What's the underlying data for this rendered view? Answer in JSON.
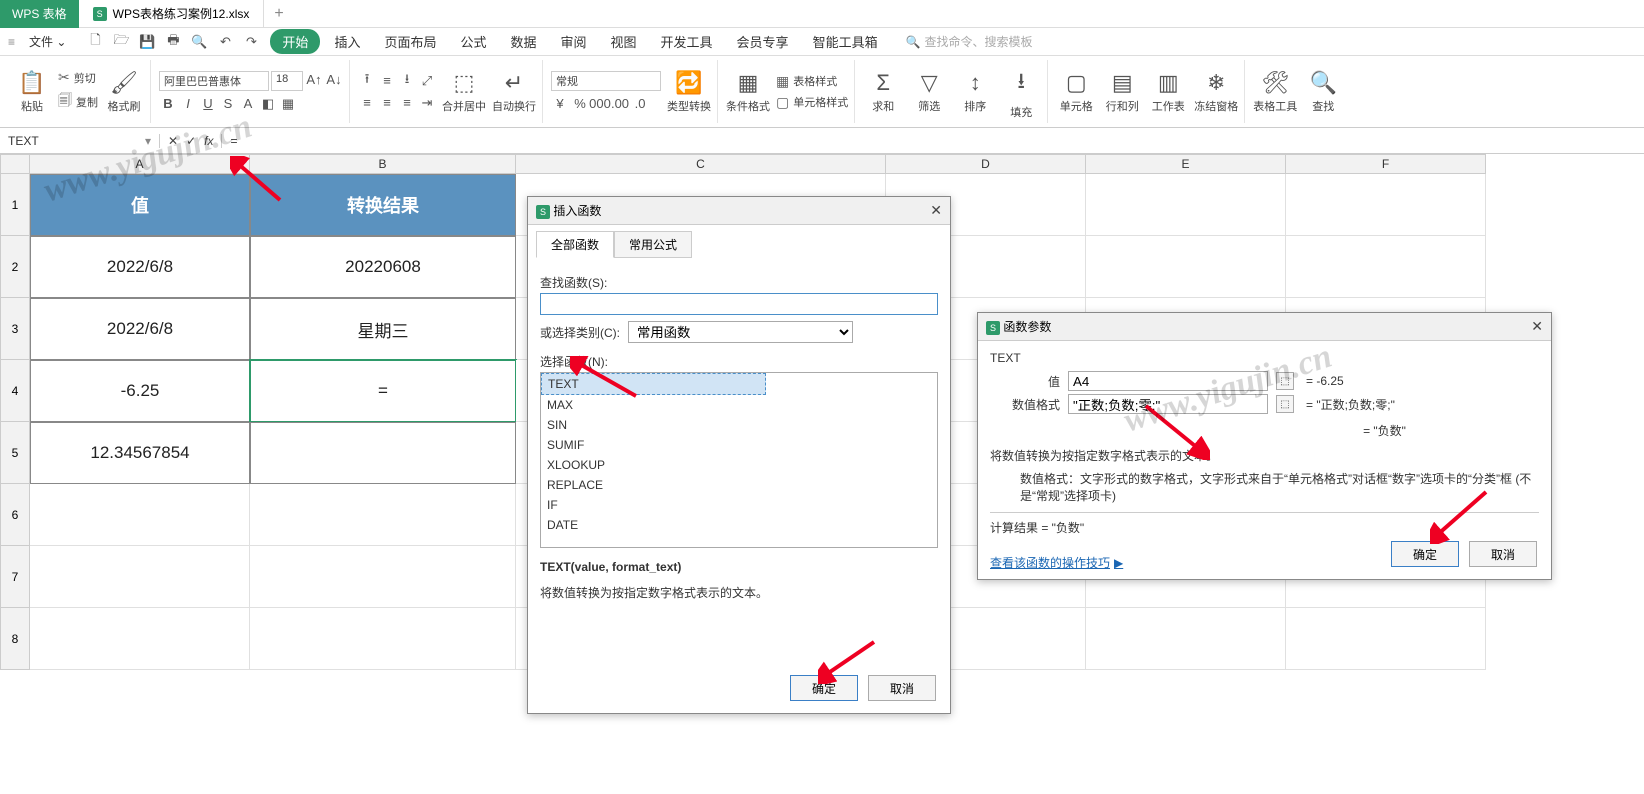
{
  "app_brand": "WPS 表格",
  "tab": {
    "filename": "WPS表格练习案例12.xlsx",
    "add": "+"
  },
  "file_menu": "文件",
  "menus": [
    "开始",
    "插入",
    "页面布局",
    "公式",
    "数据",
    "审阅",
    "视图",
    "开发工具",
    "会员专享",
    "智能工具箱"
  ],
  "search_placeholder": "查找命令、搜索模板",
  "ribbon": {
    "paste": "粘贴",
    "cut": "剪切",
    "copy": "复制",
    "format_painter": "格式刷",
    "font_family": "阿里巴巴普惠体",
    "font_size": "18",
    "merge": "合并居中",
    "wrap": "自动换行",
    "num_format": "常规",
    "type_convert": "类型转换",
    "cond_format": "条件格式",
    "table_style": "表格样式",
    "cell_style": "单元格样式",
    "sum": "求和",
    "filter": "筛选",
    "sort": "排序",
    "fill": "填充",
    "cell": "单元格",
    "rowcol": "行和列",
    "sheet": "工作表",
    "freeze": "冻结窗格",
    "tools": "表格工具",
    "find": "查找"
  },
  "name_box": "TEXT",
  "formula_input": "=",
  "cols": {
    "A": "A",
    "B": "B",
    "C": "C",
    "D": "D",
    "E": "E",
    "F": "F"
  },
  "sheet": {
    "headers": {
      "A": "值",
      "B": "转换结果"
    },
    "rows": [
      {
        "r": 2,
        "A": "2022/6/8",
        "B": "20220608"
      },
      {
        "r": 3,
        "A": "2022/6/8",
        "B": "星期三"
      },
      {
        "r": 4,
        "A": "-6.25",
        "B": "="
      },
      {
        "r": 5,
        "A": "12.34567854",
        "B": ""
      }
    ]
  },
  "dlg1": {
    "title": "插入函数",
    "tabs": {
      "all": "全部函数",
      "common": "常用公式"
    },
    "search_label": "查找函数(S):",
    "cat_label": "或选择类别(C):",
    "cat_value": "常用函数",
    "list_label": "选择函数(N):",
    "functions": [
      "TEXT",
      "MAX",
      "SIN",
      "SUMIF",
      "XLOOKUP",
      "REPLACE",
      "IF",
      "DATE"
    ],
    "sig": "TEXT(value, format_text)",
    "desc": "将数值转换为按指定数字格式表示的文本。",
    "ok": "确定",
    "cancel": "取消"
  },
  "dlg2": {
    "title": "函数参数",
    "fn": "TEXT",
    "p1_lbl": "值",
    "p1_val": "A4",
    "p1_res": "= -6.25",
    "p2_lbl": "数值格式",
    "p2_val": "\"正数;负数;零;\"",
    "p2_res": "= \"正数;负数;零;\"",
    "mid_res": "= \"负数\"",
    "desc1": "将数值转换为按指定数字格式表示的文本。",
    "desc2": "数值格式：文字形式的数字格式，文字形式来自于“单元格格式”对话框“数字”选项卡的“分类”框 (不是“常规”选择项卡)",
    "result_label": "计算结果 = \"负数\"",
    "link": "查看该函数的操作技巧",
    "ok": "确定",
    "cancel": "取消"
  },
  "watermark": "www.yigujin.cn"
}
